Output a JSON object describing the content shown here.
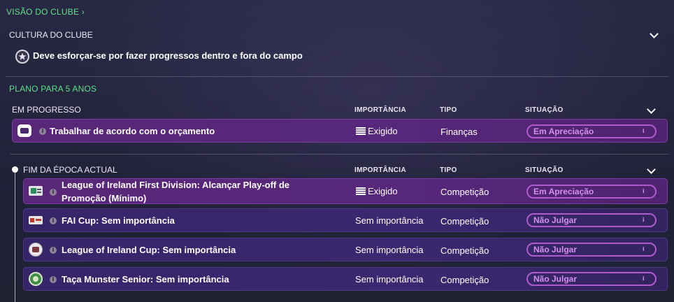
{
  "breadcrumb": {
    "label": "VISÃO DO CLUBE",
    "arrow": "›"
  },
  "culture": {
    "title": "CULTURA DO CLUBE",
    "item": "Deve esforçar-se por fazer progressos dentro e fora do campo"
  },
  "plan": {
    "title": "PLANO PARA 5 ANOS"
  },
  "in_progress": {
    "title": "EM PROGRESSO",
    "columns": {
      "importance": "IMPORTÂNCIA",
      "type": "TIPO",
      "status": "SITUAÇÃO"
    },
    "rows": [
      {
        "title": "Trabalhar de acordo com o orçamento",
        "importance": "Exigido",
        "type": "Finanças",
        "status": "Em Apreciação"
      }
    ]
  },
  "season_end": {
    "title": "FIM DA ÉPOCA ACTUAL",
    "columns": {
      "importance": "IMPORTÂNCIA",
      "type": "TIPO",
      "status": "SITUAÇÃO"
    },
    "rows": [
      {
        "title_line1": "League of Ireland First Division: Alcançar Play-off de",
        "title_line2": "Promoção (Mínimo)",
        "importance": "Exigido",
        "type": "Competição",
        "status": "Em Apreciação"
      },
      {
        "title": "FAI Cup: Sem importância",
        "importance": "Sem importância",
        "type": "Competição",
        "status": "Não Julgar"
      },
      {
        "title": "League of Ireland Cup: Sem importância",
        "importance": "Sem importância",
        "type": "Competição",
        "status": "Não Julgar"
      },
      {
        "title": "Taça Munster Senior: Sem importância",
        "importance": "Sem importância",
        "type": "Competição",
        "status": "Não Julgar"
      }
    ]
  },
  "icons": {
    "info": "i"
  },
  "colors": {
    "accent_green": "#5fe08a",
    "required_row": "#56277a",
    "optional_row": "#3a2870",
    "status_badge": "#b05ad0"
  }
}
